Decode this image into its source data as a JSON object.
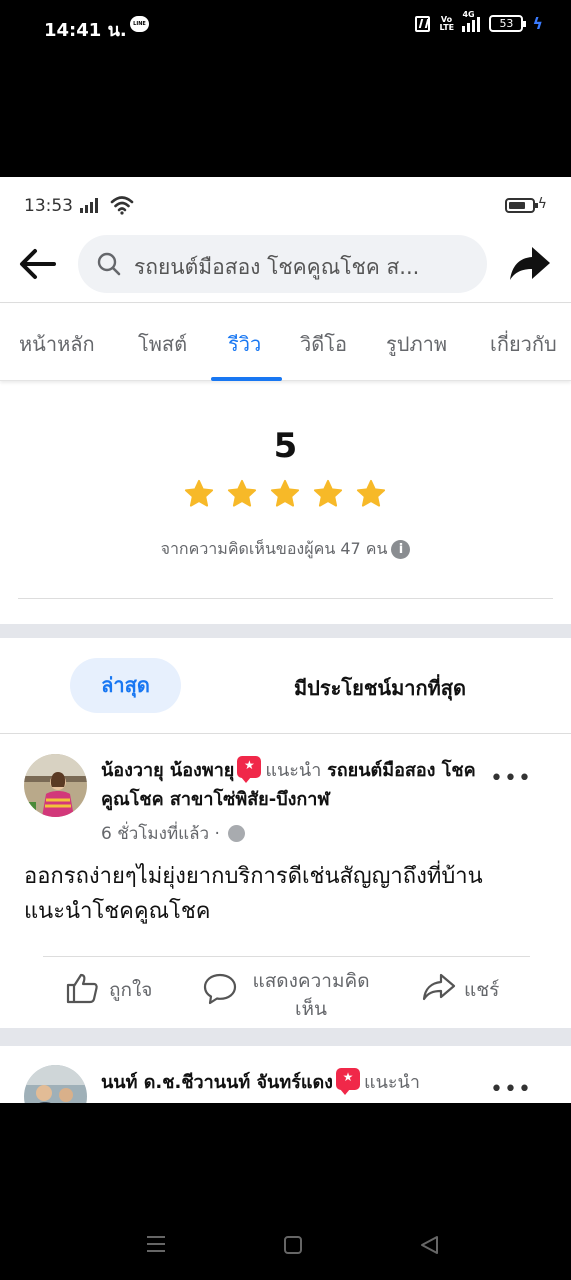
{
  "outer_status": {
    "time": "14:41 น.",
    "line_label": "LINE",
    "volte": "Vo LTE",
    "network": "4G",
    "battery": "53"
  },
  "inner_status": {
    "time": "13:53"
  },
  "search": {
    "query": "รถยนต์มือสอง โชคคูณโชค ส..."
  },
  "tabs": [
    {
      "label": "หน้าหลัก",
      "active": false
    },
    {
      "label": "โพสต์",
      "active": false
    },
    {
      "label": "รีวิว",
      "active": true
    },
    {
      "label": "วิดีโอ",
      "active": false
    },
    {
      "label": "รูปภาพ",
      "active": false
    },
    {
      "label": "เกี่ยวกับ",
      "active": false
    }
  ],
  "rating": {
    "score": "5",
    "stars": 5,
    "based_on": "จากความคิดเห็นของผู้คน 47 คน",
    "star_color": "#f7b928"
  },
  "sort": {
    "latest": "ล่าสุด",
    "most_helpful": "มีประโยชน์มากที่สุด"
  },
  "review1": {
    "author": "น้องวายุ น้องพายุ",
    "recommends": "แนะนำ",
    "page": "รถยนต์มือสอง โชคคูณโชค สาขาโซ่พิสัย-บึงกาฬ",
    "time": "6 ชั่วโมงที่แล้ว ·",
    "body": "ออกรถง่ายๆไม่ยุ่งยากบริการดีเช่นสัญญาถึงที่บ้านแนะนำโชคคูณโชค",
    "like": "ถูกใจ",
    "comment": "แสดงความคิดเห็น",
    "share": "แชร์"
  },
  "review2": {
    "author": "นนท์ ด.ช.ชีวานนท์ จันทร์แดง",
    "recommends": "แนะนำ"
  },
  "colors": {
    "accent": "#1877f2",
    "recommend_badge": "#f02849"
  }
}
